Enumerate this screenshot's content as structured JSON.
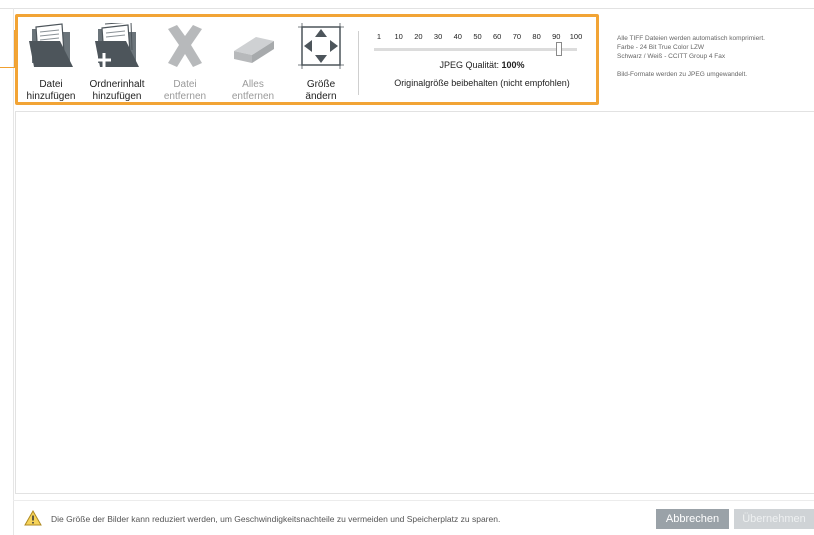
{
  "toolbar": {
    "buttons": [
      {
        "label": "Datei\nhinzufügen",
        "icon": "folder-add-file-icon",
        "enabled": true
      },
      {
        "label": "Ordnerinhalt\nhinzufügen",
        "icon": "folder-add-contents-icon",
        "enabled": true
      },
      {
        "label": "Datei\nentfernen",
        "icon": "remove-x-icon",
        "enabled": false
      },
      {
        "label": "Alles\nentfernen",
        "icon": "eraser-icon",
        "enabled": false
      },
      {
        "label": "Größe\nändern",
        "icon": "resize-icon",
        "enabled": true
      }
    ],
    "quality": {
      "scale": [
        "1",
        "10",
        "20",
        "30",
        "40",
        "50",
        "60",
        "70",
        "80",
        "90",
        "100"
      ],
      "label": "JPEG Qualität:",
      "value": "100%",
      "level": 1.0,
      "original_size": "Originalgröße beibehalten (nicht empfohlen)"
    },
    "info": [
      "Alle TIFF Dateien werden automatisch komprimiert.",
      "Farbe - 24 Bit True Color LZW",
      "Schwarz / Weiß - CCITT Group 4 Fax",
      "",
      "Bild-Formate werden zu JPEG umgewandelt."
    ]
  },
  "footer": {
    "warning_icon": "warning-triangle-icon",
    "hint": "Die Größe der Bilder kann reduziert werden, um Geschwindigkeitsnachteile zu vermeiden und Speicherplatz zu sparen.",
    "cancel_label": "Abbrechen",
    "apply_label": "Übernehmen"
  },
  "colors": {
    "highlight": "#f2a435",
    "icon_dark": "#4d555b",
    "icon_disabled": "#b7b9bb",
    "cancel_button": "#9aa2a8",
    "apply_button_disabled": "#cfd3d6"
  }
}
